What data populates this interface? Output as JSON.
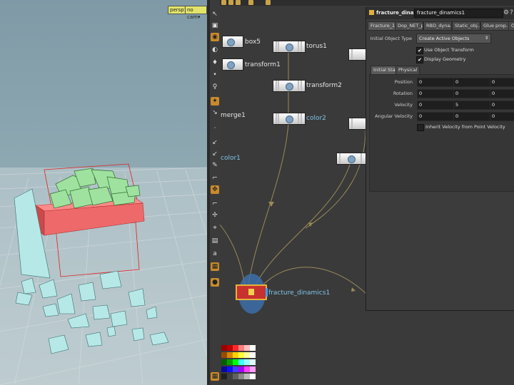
{
  "viewport": {
    "camera_menu": "persp1",
    "cam_menu": "no cam"
  },
  "toolbar_icons": [
    "arrow-icon",
    "lock-icon",
    "camera-icon",
    "eye-icon",
    "light-icon",
    "bulb-icon",
    "person-icon",
    "tool-icon",
    "cursor-icon",
    "dot-icon",
    "brush-icon",
    "brush2-icon",
    "pencil-icon",
    "snap-icon",
    "move-icon",
    "rotate-icon",
    "scale-icon",
    "grid-icon",
    "ruler-icon",
    "magnet-icon",
    "measure-icon",
    "stack-icon",
    "abc-icon",
    "layers-icon",
    "pin-icon"
  ],
  "network": {
    "nodes": [
      {
        "name": "box-node",
        "label": "box5"
      },
      {
        "name": "transform1-node",
        "label": "transform1"
      },
      {
        "name": "merge1-node",
        "label": "merge1"
      },
      {
        "name": "color1-node",
        "label": "color1"
      },
      {
        "name": "torus1-node",
        "label": "torus1"
      },
      {
        "name": "transform2-node",
        "label": "transform2"
      },
      {
        "name": "color2-node",
        "label": "color2"
      },
      {
        "name": "fracture-dynamics-node",
        "label": "fracture_dinamics1"
      }
    ]
  },
  "params": {
    "node_type": "fracture_dinamics",
    "node_name": "fracture_dinamics1",
    "tabs": [
      "Fracture_1...",
      "Dop_NET_p...",
      "RBD_dyna...",
      "Static_obj...",
      "Glue prop...",
      "Ot"
    ],
    "initial_object_type_label": "Initial Object Type",
    "initial_object_type_value": "Create Active Objects",
    "use_object_transform": "Use Object Transform",
    "display_geometry": "Display Geometry",
    "subtabs": [
      "Initial State",
      "Physical"
    ],
    "rows": [
      {
        "label": "Position",
        "values": [
          "0",
          "0",
          "0"
        ]
      },
      {
        "label": "Rotation",
        "values": [
          "0",
          "0",
          "0"
        ]
      },
      {
        "label": "Velocity",
        "values": [
          "0",
          "5",
          "0"
        ]
      },
      {
        "label": "Angular Velocity",
        "values": [
          "0",
          "0",
          "0"
        ]
      }
    ],
    "inherit_label": "Inherit Velocity from Point Velocity"
  },
  "palette_colors": [
    [
      "#9a0000",
      "#c00000",
      "#ff2a2a",
      "#ff8080",
      "#ffc0c0",
      "#ffffff"
    ],
    [
      "#9a4a00",
      "#d48a00",
      "#ffd000",
      "#ffff40",
      "#ffffa0",
      "#ffffff"
    ],
    [
      "#006000",
      "#00a000",
      "#00ff00",
      "#40ffff",
      "#a0ffff",
      "#e0ffff"
    ],
    [
      "#0a0a90",
      "#1010ff",
      "#4040ff",
      "#a000ff",
      "#ff40ff",
      "#ffa0ff"
    ],
    [
      "#202020",
      "#404040",
      "#606060",
      "#8a8a8a",
      "#bbbbbb",
      "#ffffff"
    ]
  ]
}
